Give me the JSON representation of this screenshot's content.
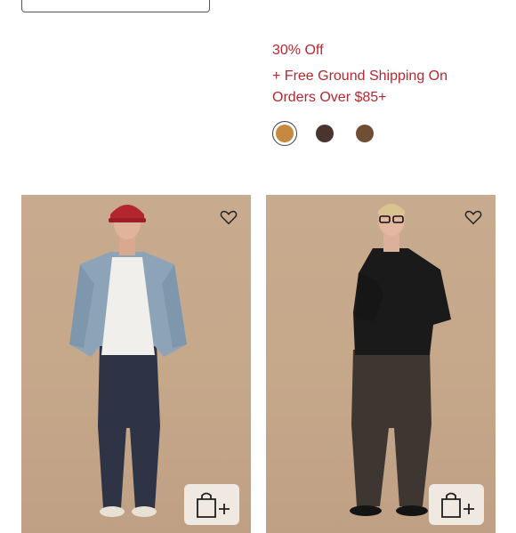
{
  "promo": {
    "discount": "30% Off",
    "shipping_line1": "+ Free Ground Shipping On",
    "shipping_line2": "Orders Over $85+"
  },
  "colors": {
    "promo_red": "#b5282f",
    "swatch_tan": "#c58a3f",
    "swatch_dark_brown": "#4a3430",
    "swatch_olive_brown": "#6e4f34",
    "photo_background": "#c8ab8e"
  },
  "swatches": [
    {
      "name": "tan",
      "color": "#c58a3f",
      "selected": true
    },
    {
      "name": "dark-brown",
      "color": "#4a3430",
      "selected": false
    },
    {
      "name": "olive-brown",
      "color": "#6e4f34",
      "selected": false
    }
  ],
  "products": [
    {
      "id": "left",
      "icons": [
        "heart-icon",
        "shopping-bag-plus-icon"
      ]
    },
    {
      "id": "right",
      "icons": [
        "heart-icon",
        "shopping-bag-plus-icon"
      ]
    }
  ]
}
